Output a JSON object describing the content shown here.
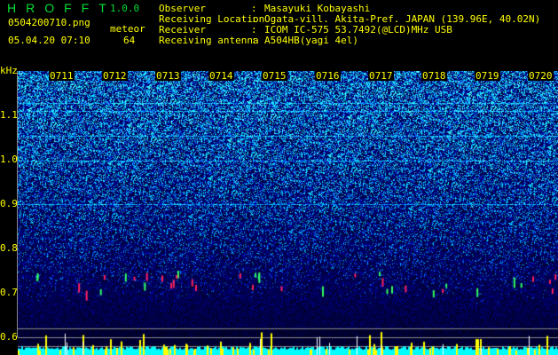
{
  "header": {
    "app_name": "HROFFT",
    "version": "1.0.0",
    "filename": "0504200710.png",
    "timestamp": "05.04.20 07:10",
    "meteor_label": "meteor",
    "meteor_count": "64"
  },
  "info": [
    {
      "label": "Observer",
      "value": "Masayuki Kobayashi"
    },
    {
      "label": "Receiving Location",
      "value": "Ogata-vill. Akita-Pref. JAPAN (139.96E, 40.02N)"
    },
    {
      "label": "Receiver",
      "value": "ICOM IC-575 53.7492(@LCD)MHz USB"
    },
    {
      "label": "Receiving antenna",
      "value": "A504HB(yagi 4el)"
    }
  ],
  "axis": {
    "y_unit": "kHz",
    "y_ticks": [
      "1.1",
      "1.0",
      "0.9",
      "0.8",
      "0.7",
      "0.6"
    ],
    "x_ticks": [
      "0711",
      "0712",
      "0713",
      "0714",
      "0715",
      "0716",
      "0717",
      "0718",
      "0719",
      "0720"
    ]
  },
  "colors": {
    "text": "#ffff00",
    "title": "#00dd33",
    "echo_bar": "#ffff00",
    "noise_bar": "#00ffff"
  }
}
